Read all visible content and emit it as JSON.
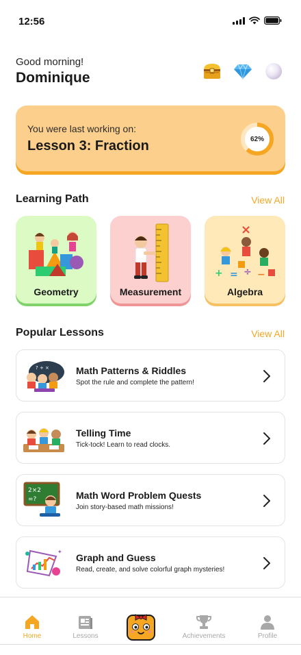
{
  "status": {
    "time": "12:56"
  },
  "header": {
    "greeting": "Good morning!",
    "name": "Dominique",
    "icons": [
      "treasure-chest-icon",
      "diamond-icon",
      "pearl-icon"
    ]
  },
  "resume": {
    "subtitle": "You were last working on:",
    "title": "Lesson 3: Fraction",
    "progress_percent": 62,
    "progress_label": "62%"
  },
  "learning_path": {
    "title": "Learning Path",
    "view_all": "View All",
    "items": [
      {
        "label": "Geometry",
        "color": "#dcfbc4"
      },
      {
        "label": "Measurement",
        "color": "#fdd0d0"
      },
      {
        "label": "Algebra",
        "color": "#ffe9b8"
      }
    ]
  },
  "popular_lessons": {
    "title": "Popular Lessons",
    "view_all": "View All",
    "items": [
      {
        "title": "Math Patterns & Riddles",
        "subtitle": "Spot the rule and complete the pattern!"
      },
      {
        "title": "Telling Time",
        "subtitle": "Tick-tock! Learn to read clocks."
      },
      {
        "title": "Math Word Problem Quests",
        "subtitle": "Join story-based math missions!"
      },
      {
        "title": "Graph and Guess",
        "subtitle": "Read, create, and solve colorful graph mysteries!"
      }
    ]
  },
  "tabs": [
    {
      "label": "Home",
      "icon": "home-icon",
      "active": true
    },
    {
      "label": "Lessons",
      "icon": "lessons-icon",
      "active": false
    },
    {
      "label": "",
      "icon": "mascot-icon",
      "active": false
    },
    {
      "label": "Achievements",
      "icon": "trophy-icon",
      "active": false
    },
    {
      "label": "Profile",
      "icon": "profile-icon",
      "active": false
    }
  ],
  "colors": {
    "accent": "#f5a623",
    "card": "#fdcf8c",
    "inactive": "#a8a8a8"
  }
}
